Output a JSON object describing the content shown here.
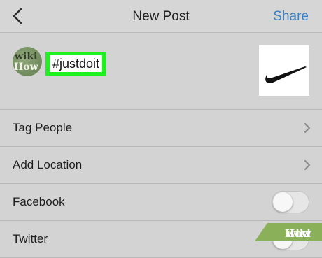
{
  "header": {
    "title": "New Post",
    "share_label": "Share",
    "back_icon": "chevron-left-icon"
  },
  "compose": {
    "avatar_top": "wiki",
    "avatar_bottom": "How",
    "caption": "#justdoit",
    "thumbnail": "nike-swoosh-image"
  },
  "rows": [
    {
      "label": "Tag People",
      "type": "chevron"
    },
    {
      "label": "Add Location",
      "type": "chevron"
    },
    {
      "label": "Facebook",
      "type": "toggle",
      "on": false
    },
    {
      "label": "Twitter",
      "type": "toggle",
      "on": false
    }
  ],
  "colors": {
    "accent": "#3b82c4",
    "highlight": "#1ef21e",
    "background": "#d3d3d3"
  },
  "watermark": {
    "wiki": "wiki",
    "how": "How"
  }
}
